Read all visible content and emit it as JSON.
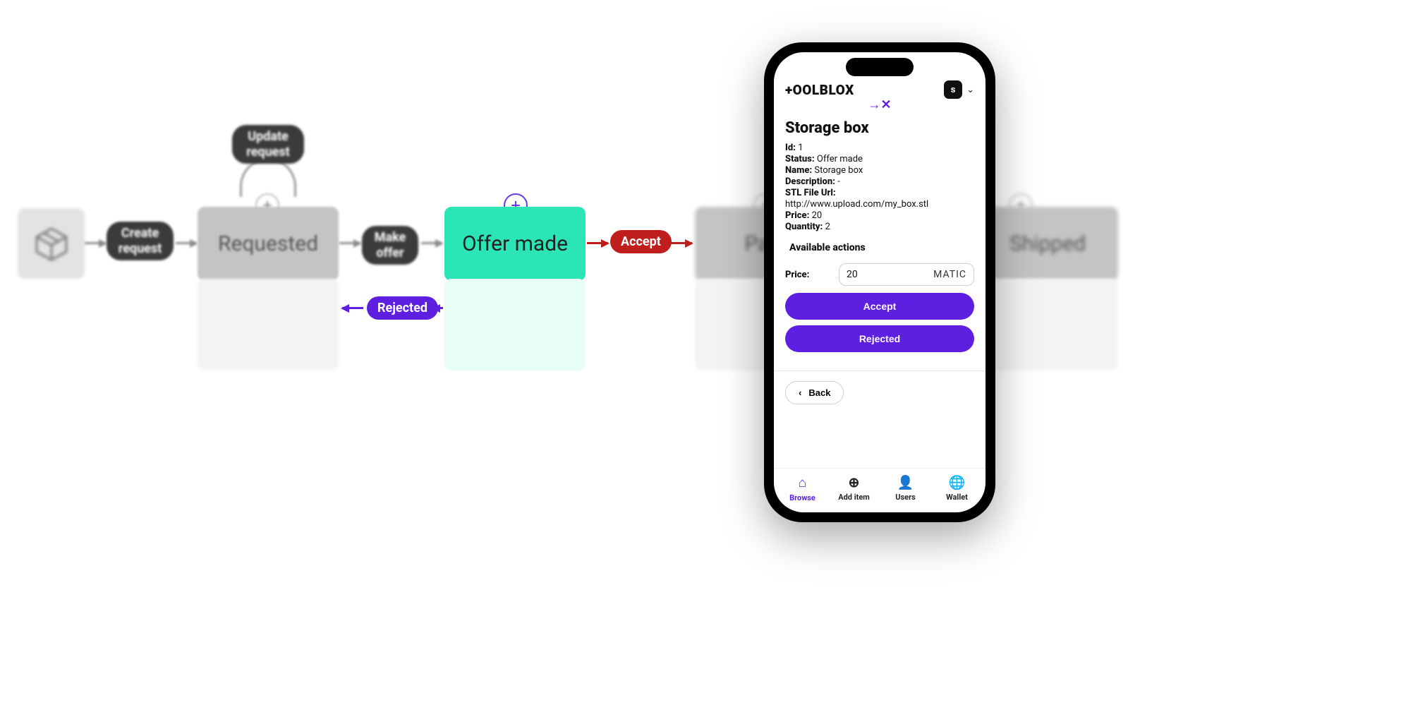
{
  "flow": {
    "actions": {
      "create": "Create request",
      "update": "Update request",
      "make_offer": "Make offer",
      "accept": "Accept",
      "rejected": "Rejected"
    },
    "states": {
      "requested": "Requested",
      "offer_made": "Offer made",
      "paid": "Paid",
      "shipped": "Shipped"
    }
  },
  "phone": {
    "brand": "+OOLBLOX",
    "avatar_letter": "s",
    "title": "Storage box",
    "fields": {
      "id_label": "Id:",
      "id_value": "1",
      "status_label": "Status:",
      "status_value": "Offer made",
      "name_label": "Name:",
      "name_value": "Storage box",
      "desc_label": "Description:",
      "desc_value": "-",
      "stl_label": "STL File Url:",
      "stl_value": "http://www.upload.com/my_box.stl",
      "price_label": "Price:",
      "price_value": "20",
      "qty_label": "Quantity:",
      "qty_value": "2"
    },
    "actions_title": "Available actions",
    "price_input": {
      "label": "Price:",
      "value": "20",
      "unit": "MATIC"
    },
    "buttons": {
      "accept": "Accept",
      "rejected": "Rejected",
      "back": "Back"
    },
    "nav": {
      "browse": "Browse",
      "add": "Add item",
      "users": "Users",
      "wallet": "Wallet"
    }
  }
}
